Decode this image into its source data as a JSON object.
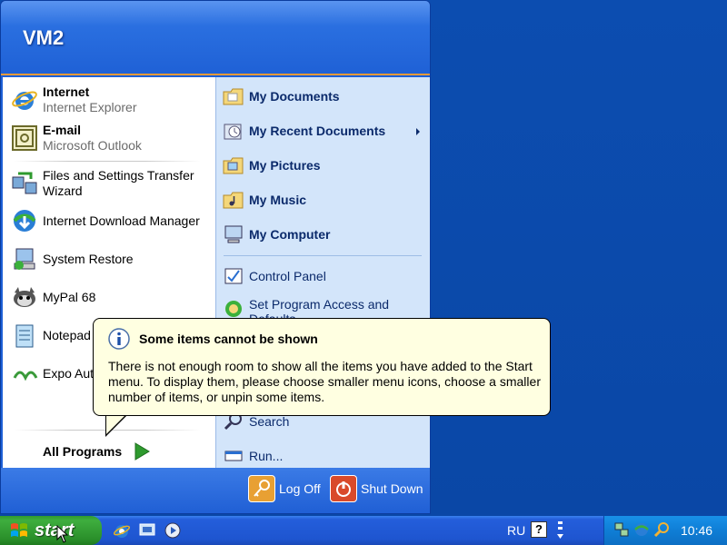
{
  "user": {
    "name": "VM2"
  },
  "pinned": [
    {
      "title": "Internet",
      "subtitle": "Internet Explorer",
      "icon": "internet-explorer-icon"
    },
    {
      "title": "E-mail",
      "subtitle": "Microsoft Outlook",
      "icon": "outlook-icon"
    }
  ],
  "recent": [
    {
      "title_line1": "Files and Settings Transfer",
      "title_line2": "Wizard",
      "icon": "transfer-wizard-icon"
    },
    {
      "title": "Internet Download Manager",
      "icon": "idm-icon"
    },
    {
      "title": "System Restore",
      "icon": "system-restore-icon"
    },
    {
      "title": "MyPal 68",
      "icon": "mypal-icon"
    },
    {
      "title": "Notepad",
      "icon": "notepad-icon"
    },
    {
      "title": "Expo Aut",
      "icon": "expo-icon"
    }
  ],
  "all_programs": "All Programs",
  "right": {
    "my_documents": "My Documents",
    "my_recent_documents": "My Recent Documents",
    "my_pictures": "My Pictures",
    "my_music": "My Music",
    "my_computer": "My Computer",
    "control_panel": "Control Panel",
    "set_program_access_l1": "Set Program Access and",
    "set_program_access_l2": "Defaults",
    "search": "Search",
    "run": "Run..."
  },
  "footer": {
    "log_off": "Log Off",
    "shut_down": "Shut Down"
  },
  "balloon": {
    "title": "Some items cannot be shown",
    "body_l1": "There is not enough room to show all the items you have added to the Start",
    "body_l2": "menu.  To display them, please choose smaller menu icons, choose a smaller",
    "body_l3": "number of items, or unpin some items."
  },
  "taskbar": {
    "start_label": "start",
    "language": "RU",
    "help": "?",
    "clock": "10:46"
  },
  "colors": {
    "start_green": "#3fae3f",
    "taskbar_blue": "#245edb",
    "balloon_bg": "#ffffe1"
  }
}
